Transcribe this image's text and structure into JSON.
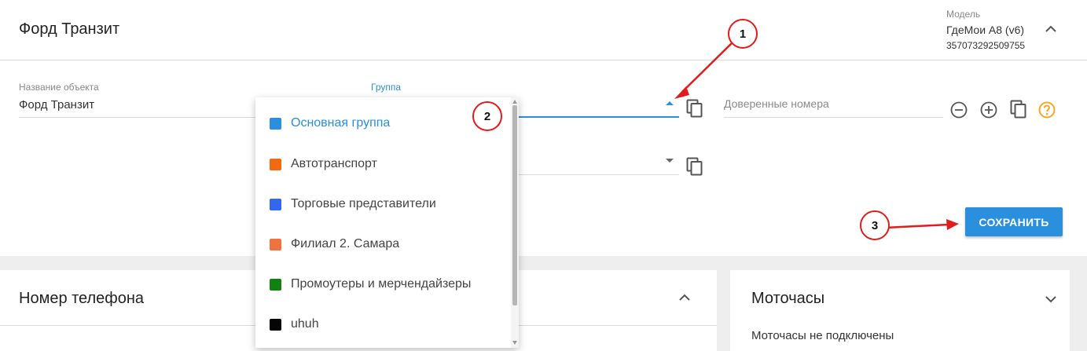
{
  "header": {
    "title": "Форд Транзит",
    "model_label": "Модель",
    "model_value": "ГдеМои A8 (v6)",
    "imei": "357073292509755"
  },
  "form": {
    "object_name_label": "Название объекта",
    "object_name_value": "Форд Транзит",
    "group_label": "Группа",
    "trusted_numbers_placeholder": "Доверенные номера",
    "save_label": "СОХРАНИТЬ"
  },
  "dropdown": {
    "items": [
      {
        "label": "Основная группа",
        "color": "#2a8fdd",
        "selected": true
      },
      {
        "label": "Автотранспорт",
        "color": "#f26a10"
      },
      {
        "label": "Торговые представители",
        "color": "#3466f0"
      },
      {
        "label": "Филиал 2. Самара",
        "color": "#ef7340"
      },
      {
        "label": "Промоутеры и мерчендайзеры",
        "color": "#118211"
      },
      {
        "label": "uhuh",
        "color": "#050505"
      }
    ]
  },
  "phone_card": {
    "title": "Номер телефона"
  },
  "moto_card": {
    "title": "Моточасы",
    "status": "Моточасы не подключены"
  },
  "annotations": [
    "1",
    "2",
    "3"
  ],
  "colors": {
    "accent": "#2a8fdd",
    "annotation": "#e21b1b",
    "help": "#f5a623"
  }
}
